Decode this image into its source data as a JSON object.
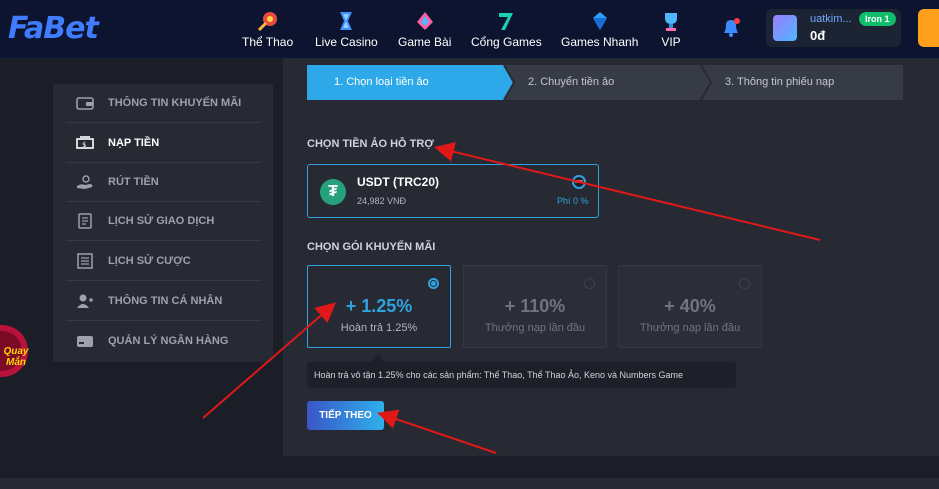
{
  "header": {
    "logo": "FaBet",
    "nav": [
      {
        "label": "Thể Thao",
        "icon": "sports-ball-icon"
      },
      {
        "label": "Live Casino",
        "icon": "casino-chip-icon"
      },
      {
        "label": "Game Bài",
        "icon": "spade-card-icon"
      },
      {
        "label": "Cổng Games",
        "icon": "seven-slot-icon"
      },
      {
        "label": "Games Nhanh",
        "icon": "gem-icon"
      },
      {
        "label": "VIP",
        "icon": "trophy-icon"
      }
    ],
    "user": {
      "username": "uatkim...",
      "rank": "Iron 1",
      "balance": "0đ"
    }
  },
  "promo_badge": {
    "text_line1": "Quay",
    "text_line2": "Mắn"
  },
  "sidebar": {
    "items": [
      {
        "label": "THÔNG TIN KHUYẾN MÃI",
        "icon": "wallet-icon"
      },
      {
        "label": "NẠP TIỀN",
        "icon": "deposit-cash-icon",
        "active": true
      },
      {
        "label": "RÚT TIỀN",
        "icon": "withdraw-hand-icon"
      },
      {
        "label": "LỊCH SỬ GIAO DỊCH",
        "icon": "transaction-history-icon"
      },
      {
        "label": "LỊCH SỬ CƯỢC",
        "icon": "bet-history-icon"
      },
      {
        "label": "THÔNG TIN CÁ NHÂN",
        "icon": "user-profile-icon"
      },
      {
        "label": "QUẢN LÝ NGÂN HÀNG",
        "icon": "bank-card-icon"
      }
    ]
  },
  "steps": [
    {
      "label": "1. Chọn loại tiền ảo",
      "active": true
    },
    {
      "label": "2. Chuyển tiền ảo",
      "active": false
    },
    {
      "label": "3. Thông tin phiếu nạp",
      "active": false
    }
  ],
  "crypto_section": {
    "title": "CHỌN TIỀN ẢO HỖ TRỢ",
    "coin": {
      "name": "USDT (TRC20)",
      "price": "24,982 VNĐ",
      "fee": "Phí 0 %"
    }
  },
  "promo_section": {
    "title": "CHỌN GÓI KHUYẾN MÃI",
    "options": [
      {
        "value": "+ 1.25%",
        "desc": "Hoàn trả 1.25%",
        "selected": true
      },
      {
        "value": "+ 110%",
        "desc": "Thưởng nạp lần đầu",
        "selected": false
      },
      {
        "value": "+ 40%",
        "desc": "Thưởng nạp lần đầu",
        "selected": false
      }
    ],
    "tooltip": "Hoàn trả vô tận 1.25% cho các sản phẩm: Thể Thao, Thể Thao Ảo, Keno và Numbers Game"
  },
  "next_button": "TIẾP THEO",
  "colors": {
    "header_bg": "#0d1430",
    "accent": "#2fa3e0",
    "panel_bg": "#272a33",
    "annotation_arrow": "#e01818"
  }
}
